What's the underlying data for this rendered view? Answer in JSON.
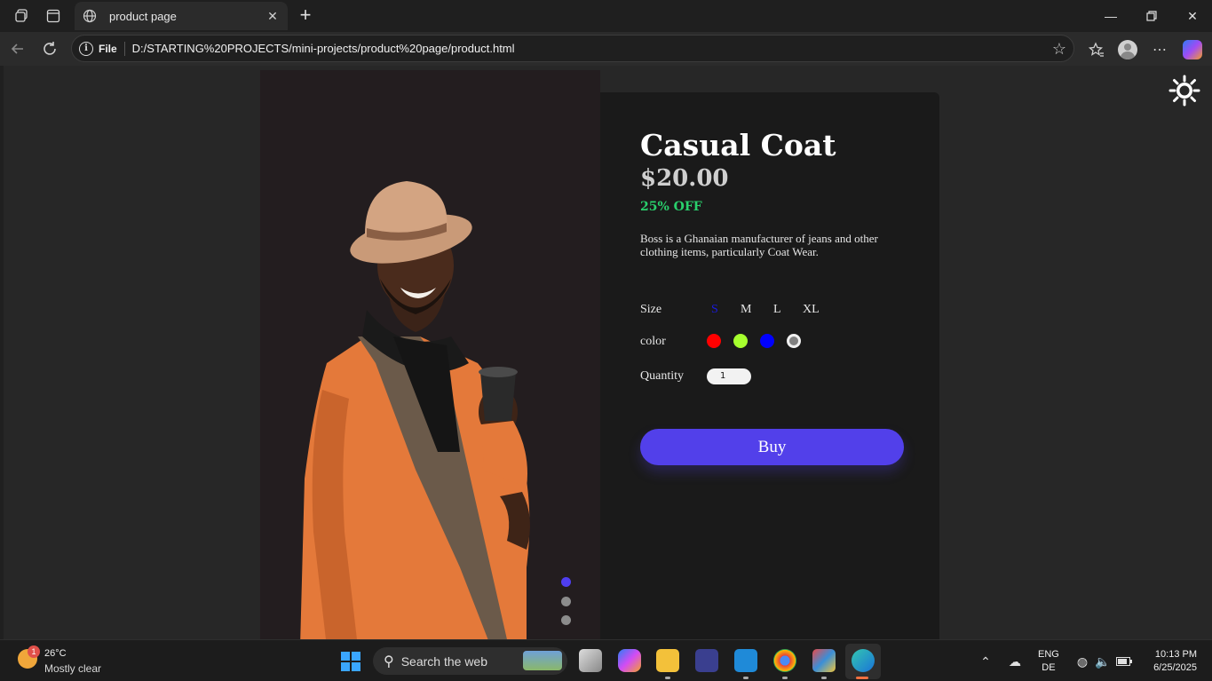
{
  "browser": {
    "tab_title": "product page",
    "url_scheme_label": "File",
    "url": "D:/STARTING%20PROJECTS/mini-projects/product%20page/product.html"
  },
  "product": {
    "title": "Casual Coat",
    "price": "$20.00",
    "discount": "25% OFF",
    "description": "Boss is a Ghanaian manufacturer of jeans and other clothing items, particularly Coat Wear.",
    "size_label": "Size",
    "sizes": [
      "S",
      "M",
      "L",
      "XL"
    ],
    "selected_size": "S",
    "color_label": "color",
    "colors": [
      "#ff0000",
      "#a6ff2e",
      "#0000ff",
      "#808080"
    ],
    "selected_color": "#808080",
    "quantity_label": "Quantity",
    "quantity": "1",
    "buy_label": "Buy"
  },
  "carousel": {
    "slides": 3,
    "active": 0,
    "active_color": "#4f3ef0",
    "inactive_color": "#8c8c8c"
  },
  "taskbar": {
    "weather_temp": "26°C",
    "weather_cond": "Mostly clear",
    "weather_badge": "1",
    "search_placeholder": "Search the web",
    "lang_top": "ENG",
    "lang_bottom": "DE",
    "time": "10:13 PM",
    "date": "6/25/2025"
  }
}
